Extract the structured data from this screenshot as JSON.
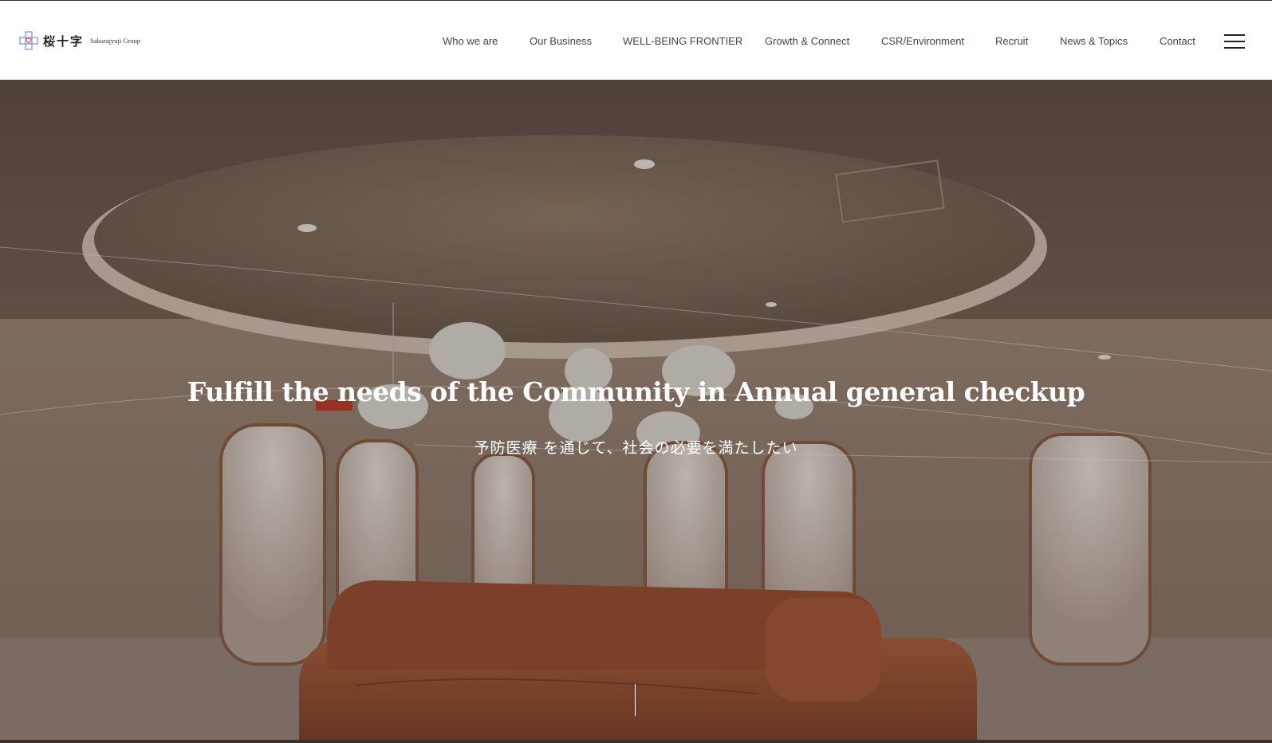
{
  "brand": {
    "logo_jp": "桜十字",
    "logo_en": "Sakurajyuji Group",
    "mark_icon": "cross-heart-logo-icon"
  },
  "nav": {
    "items": [
      {
        "label": "Who we are"
      },
      {
        "label": "Our Business"
      },
      {
        "label": "WELL-BEING FRONTIER"
      },
      {
        "label": "Growth & Connect"
      },
      {
        "label": "CSR/Environment"
      },
      {
        "label": "Recruit"
      },
      {
        "label": "News & Topics"
      },
      {
        "label": "Contact"
      }
    ],
    "menu_icon": "hamburger-menu-icon"
  },
  "hero": {
    "headline": "Fulfill the needs of the Community  in Annual general checkup",
    "subline": "予防医療 を通じて、社会の必要を満たしたい",
    "scroll_icon": "scroll-indicator-line"
  },
  "colors": {
    "header_bg": "#ffffff",
    "nav_text": "#444444",
    "hero_text": "#ffffff",
    "sofa": "#a2543a",
    "logo_blue": "#7d8ec4",
    "logo_red": "#d2566a"
  }
}
